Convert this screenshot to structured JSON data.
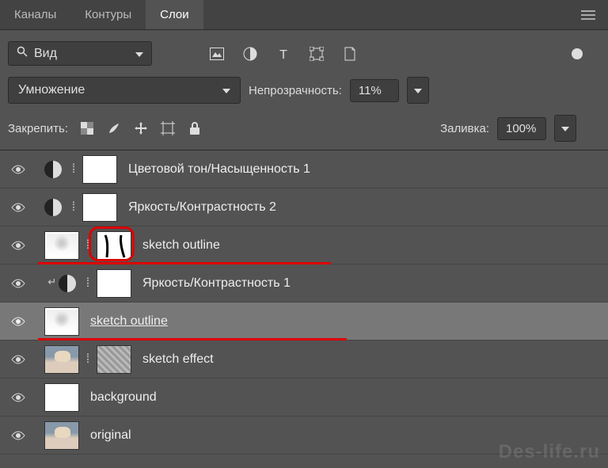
{
  "tabs": {
    "channels": "Каналы",
    "paths": "Контуры",
    "layers": "Слои"
  },
  "toolbar": {
    "kind_label": "Вид",
    "blend_mode": "Умножение",
    "opacity_label": "Непрозрачность:",
    "opacity_value": "11%",
    "lock_label": "Закрепить:",
    "fill_label": "Заливка:",
    "fill_value": "100%"
  },
  "layers": [
    {
      "name": "Цветовой тон/Насыщенность 1"
    },
    {
      "name": "Яркость/Контрастность 2"
    },
    {
      "name": "sketch outline"
    },
    {
      "name": "Яркость/Контрастность 1"
    },
    {
      "name": "sketch outline"
    },
    {
      "name": "sketch effect"
    },
    {
      "name": "background"
    },
    {
      "name": "original"
    }
  ],
  "watermark": "Des-life.ru"
}
